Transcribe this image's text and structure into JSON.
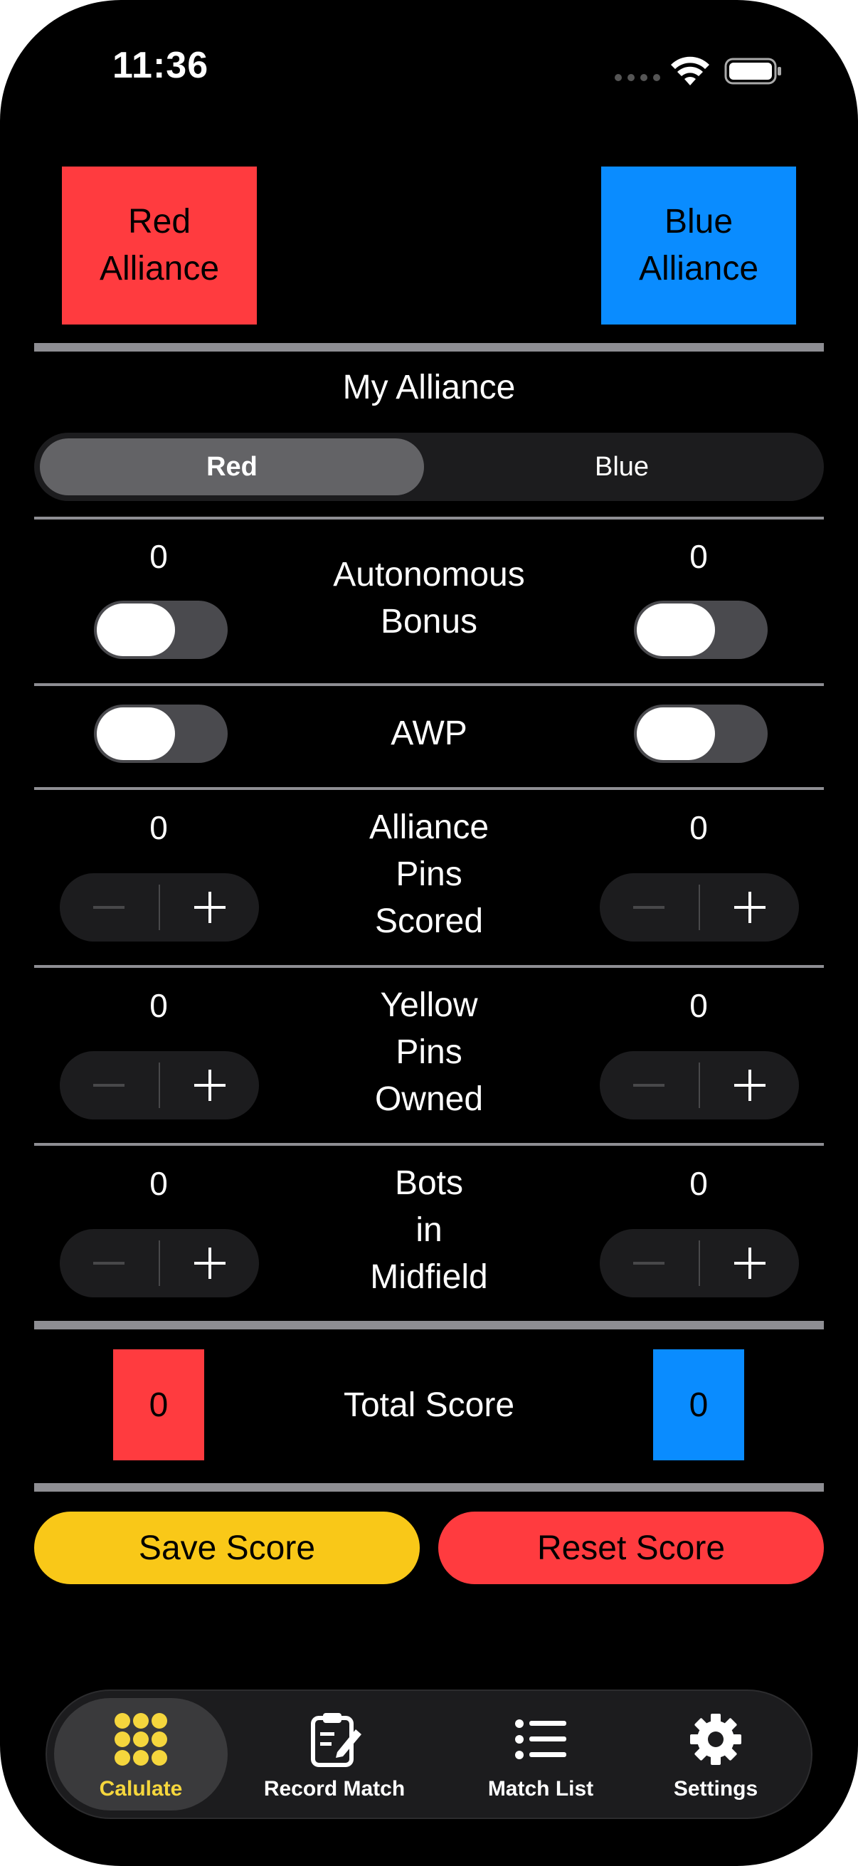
{
  "status_bar": {
    "time": "11:36"
  },
  "alliances": {
    "red": {
      "label": "Red\nAlliance",
      "color": "#FF3B3F"
    },
    "blue": {
      "label": "Blue\nAlliance",
      "color": "#0A8CFF"
    }
  },
  "my_alliance": {
    "title": "My Alliance",
    "options": [
      "Red",
      "Blue"
    ],
    "selected": "Red"
  },
  "rows": {
    "autonomous_bonus": {
      "label": "Autonomous\nBonus",
      "red_value": "0",
      "blue_value": "0",
      "red_on": false,
      "blue_on": false
    },
    "awp": {
      "label": "AWP",
      "red_on": false,
      "blue_on": false
    },
    "alliance_pins_scored": {
      "label": "Alliance\nPins\nScored",
      "red_value": "0",
      "blue_value": "0"
    },
    "yellow_pins_owned": {
      "label": "Yellow\nPins\nOwned",
      "red_value": "0",
      "blue_value": "0"
    },
    "bots_in_midfield": {
      "label": "Bots\nin\nMidfield",
      "red_value": "0",
      "blue_value": "0"
    }
  },
  "total": {
    "label": "Total Score",
    "red_value": "0",
    "blue_value": "0"
  },
  "actions": {
    "save_label": "Save Score",
    "save_color": "#F9C818",
    "reset_label": "Reset Score",
    "reset_color": "#FF3B3F"
  },
  "tabs": [
    {
      "label": "Calulate",
      "icon": "grid-dots-icon",
      "selected": true
    },
    {
      "label": "Record Match",
      "icon": "clipboard-pencil-icon",
      "selected": false
    },
    {
      "label": "Match List",
      "icon": "list-bullet-icon",
      "selected": false
    },
    {
      "label": "Settings",
      "icon": "gear-icon",
      "selected": false
    }
  ],
  "theme": {
    "accent_yellow": "#F5D63D",
    "separator": "#8E8E93"
  }
}
